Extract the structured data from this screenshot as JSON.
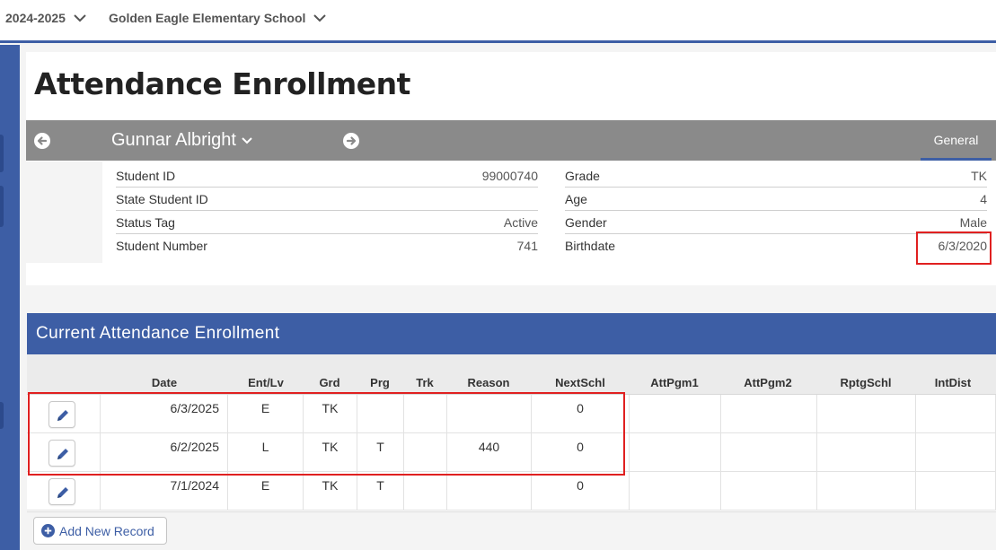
{
  "topbar": {
    "year": "2024-2025",
    "school": "Golden Eagle Elementary School"
  },
  "page_title": "Attendance Enrollment",
  "student_bar": {
    "name": "Gunnar Albright",
    "tab_general": "General"
  },
  "student_info": {
    "left": [
      {
        "label": "Student ID",
        "value": "99000740"
      },
      {
        "label": "State Student ID",
        "value": ""
      },
      {
        "label": "Status Tag",
        "value": "Active"
      },
      {
        "label": "Student Number",
        "value": "741"
      }
    ],
    "right": [
      {
        "label": "Grade",
        "value": "TK"
      },
      {
        "label": "Age",
        "value": "4"
      },
      {
        "label": "Gender",
        "value": "Male"
      },
      {
        "label": "Birthdate",
        "value": "6/3/2020"
      }
    ]
  },
  "section_title": "Current Attendance Enrollment",
  "table": {
    "headers": [
      "Date",
      "Ent/Lv",
      "Grd",
      "Prg",
      "Trk",
      "Reason",
      "NextSchl",
      "AttPgm1",
      "AttPgm2",
      "RptgSchl",
      "IntDist"
    ],
    "rows": [
      {
        "date": "6/3/2025",
        "entlv": "E",
        "grd": "TK",
        "prg": "",
        "trk": "",
        "reason": "",
        "nextschl": "0",
        "attpgm1": "",
        "attpgm2": "",
        "rptgschl": "",
        "intdist": ""
      },
      {
        "date": "6/2/2025",
        "entlv": "L",
        "grd": "TK",
        "prg": "T",
        "trk": "",
        "reason": "440",
        "nextschl": "0",
        "attpgm1": "",
        "attpgm2": "",
        "rptgschl": "",
        "intdist": ""
      },
      {
        "date": "7/1/2024",
        "entlv": "E",
        "grd": "TK",
        "prg": "T",
        "trk": "",
        "reason": "",
        "nextschl": "0",
        "attpgm1": "",
        "attpgm2": "",
        "rptgschl": "",
        "intdist": ""
      }
    ]
  },
  "add_button": "Add New Record",
  "colors": {
    "accent": "#3d5ea5",
    "student_bar": "#8a8a8a",
    "highlight": "#e02020"
  }
}
